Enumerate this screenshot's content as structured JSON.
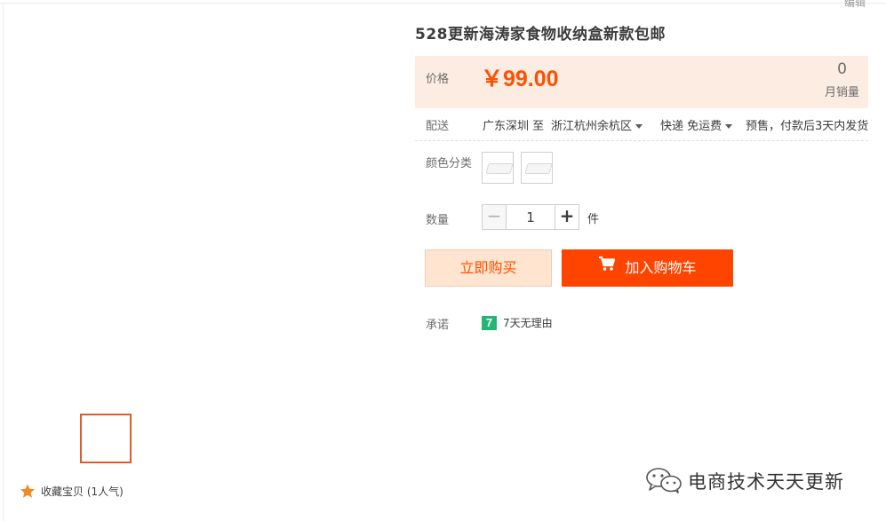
{
  "header": {
    "edit_link": "编辑"
  },
  "product": {
    "title": "528更新海涛家食物收纳盒新款包邮"
  },
  "price": {
    "label": "价格",
    "value": "￥99.00",
    "sales_count": "0",
    "sales_label": "月销量",
    "accent_color": "#ff5000"
  },
  "shipping": {
    "label": "配送",
    "from": "广东深圳 至",
    "to": "浙江杭州余杭区",
    "method": "快递 免运费",
    "note": "预售，付款后3天内发货"
  },
  "sku": {
    "label": "颜色分类",
    "options": [
      "option-1",
      "option-2"
    ]
  },
  "quantity": {
    "label": "数量",
    "value": "1",
    "minus": "−",
    "plus": "+",
    "unit": "件"
  },
  "actions": {
    "buy_now": "立即购买",
    "add_to_cart": "加入购物车",
    "primary_color": "#ff4400"
  },
  "promise": {
    "label": "承诺",
    "badge": "7",
    "text": "7天无理由"
  },
  "gallery": {
    "favorite_text": "收藏宝贝 (1人气)"
  },
  "watermark": {
    "text": "电商技术天天更新"
  }
}
